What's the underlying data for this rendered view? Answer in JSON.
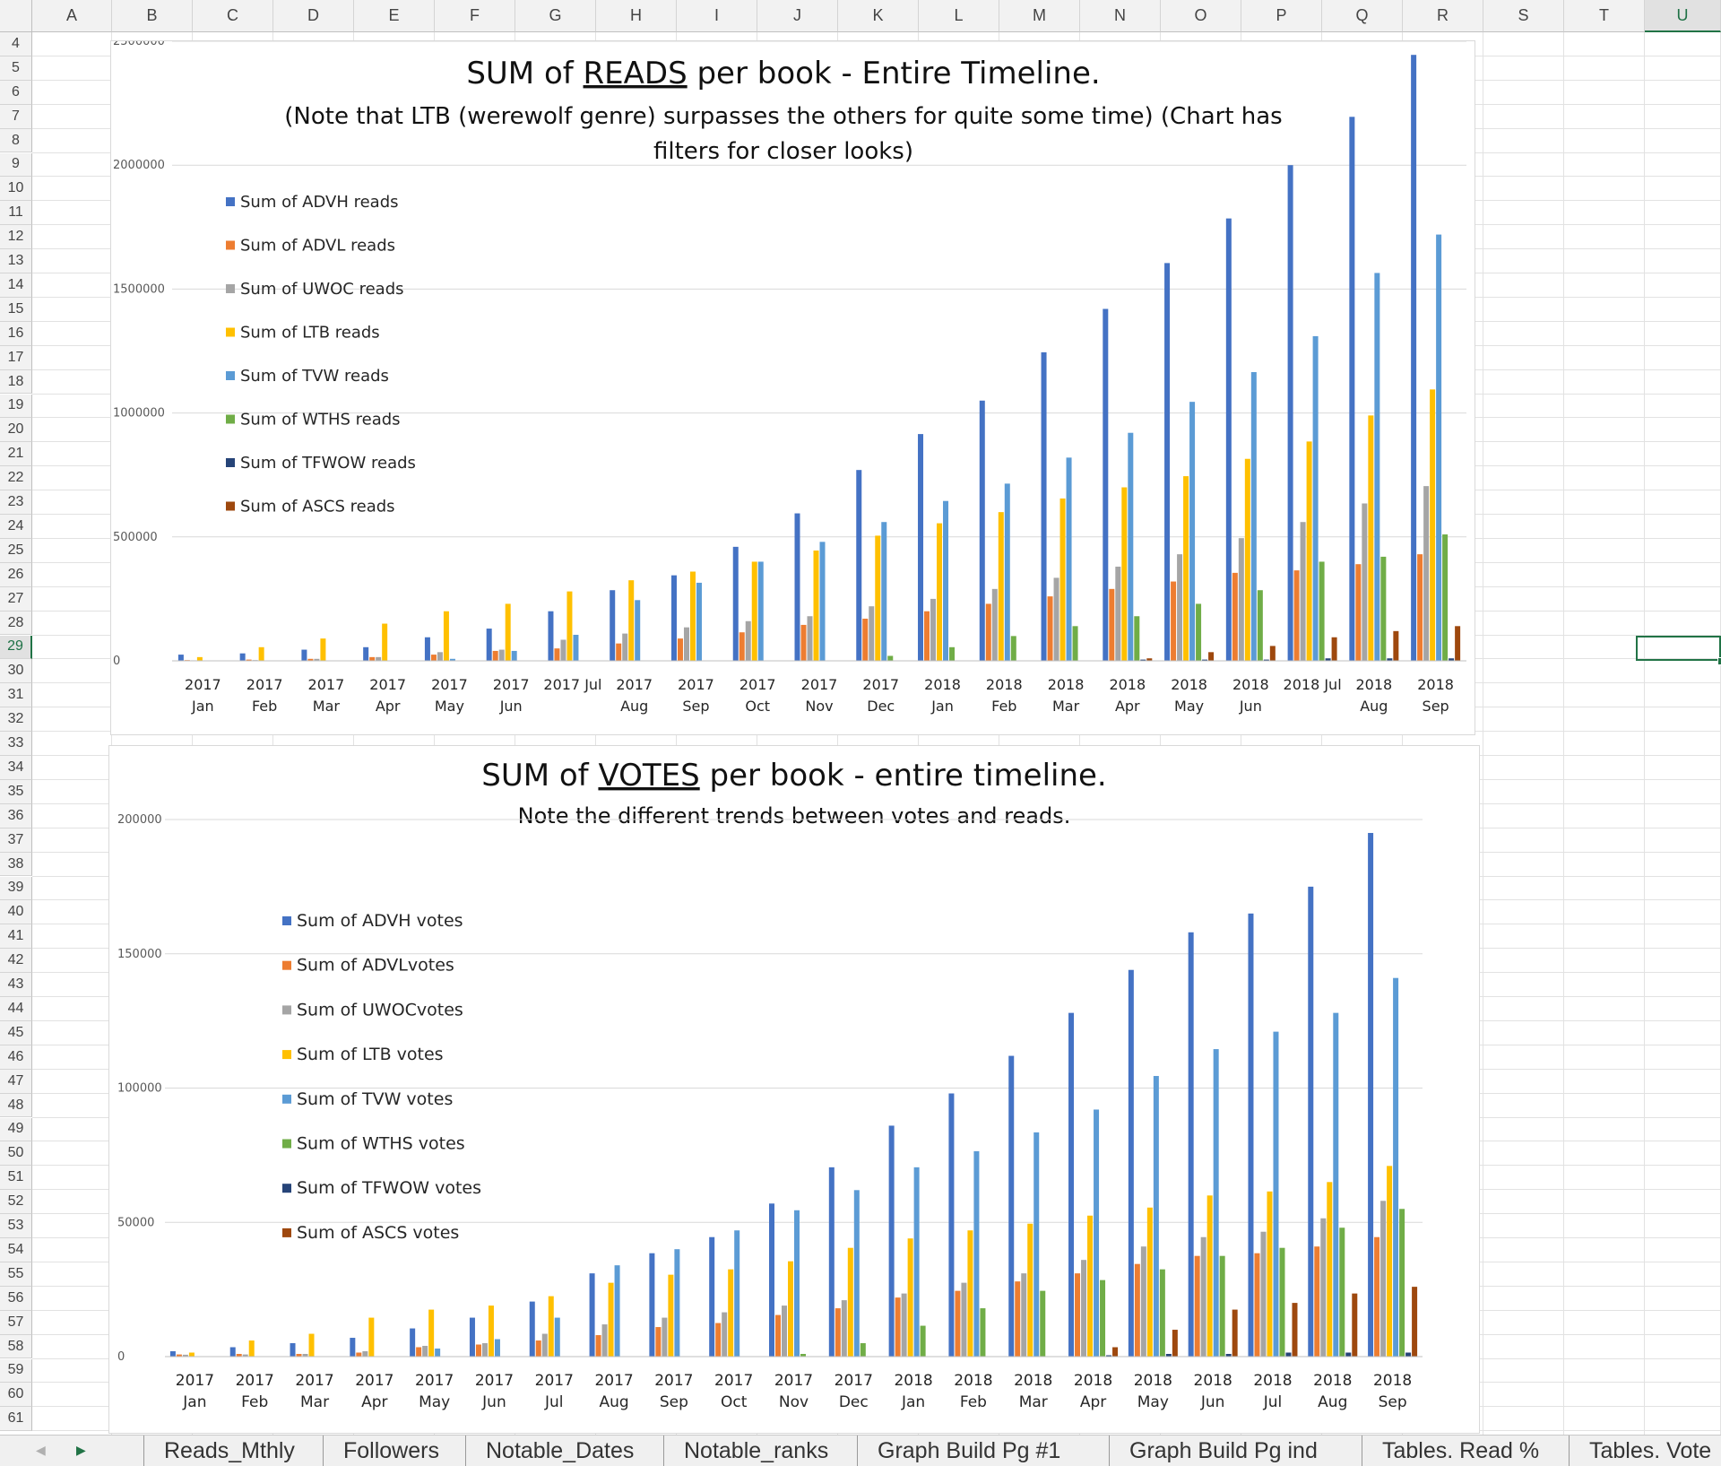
{
  "grid": {
    "columns": [
      "A",
      "B",
      "C",
      "D",
      "E",
      "F",
      "G",
      "H",
      "I",
      "J",
      "K",
      "L",
      "M",
      "N",
      "O",
      "P",
      "Q",
      "R",
      "S",
      "T",
      "U"
    ],
    "rows": [
      "4",
      "5",
      "6",
      "7",
      "8",
      "9",
      "10",
      "11",
      "12",
      "13",
      "14",
      "15",
      "16",
      "17",
      "18",
      "19",
      "20",
      "21",
      "22",
      "23",
      "24",
      "25",
      "26",
      "27",
      "28",
      "29",
      "30",
      "31",
      "32",
      "33",
      "34",
      "35",
      "36",
      "37",
      "38",
      "39",
      "40",
      "41",
      "42",
      "43",
      "44",
      "45",
      "46",
      "47",
      "48",
      "49",
      "50",
      "51",
      "52",
      "53",
      "54",
      "55",
      "56",
      "57",
      "58",
      "59",
      "60",
      "61"
    ],
    "selected_column": "U",
    "selected_row": "29"
  },
  "colors": {
    "series": [
      "#4472c4",
      "#ed7d31",
      "#a5a5a5",
      "#ffc000",
      "#5b9bd5",
      "#70ad47",
      "#264478",
      "#9e480e"
    ],
    "selection": "#217346"
  },
  "sheet_tabs": [
    "Reads_Mthly",
    "Followers",
    "Notable_Dates",
    "Notable_ranks",
    "Graph Build Pg #1",
    "Graph Build Pg ind",
    "Tables. Read %",
    "Tables. Vote"
  ],
  "chart_data": [
    {
      "type": "bar",
      "title_prefix": "SUM of ",
      "title_emph": "READS",
      "title_suffix": " per book - Entire Timeline.",
      "subtitle_lines": [
        "(Note that LTB (werewolf genre) surpasses the others for quite some time) (Chart has",
        "filters for closer looks)"
      ],
      "categories": [
        [
          "2017",
          "Jan"
        ],
        [
          "2017",
          "Feb"
        ],
        [
          "2017",
          "Mar"
        ],
        [
          "2017",
          "Apr"
        ],
        [
          "2017",
          "May"
        ],
        [
          "2017",
          "Jun"
        ],
        [
          "2017 Jul",
          ""
        ],
        [
          "2017",
          "Aug"
        ],
        [
          "2017",
          "Sep"
        ],
        [
          "2017",
          "Oct"
        ],
        [
          "2017",
          "Nov"
        ],
        [
          "2017",
          "Dec"
        ],
        [
          "2018",
          "Jan"
        ],
        [
          "2018",
          "Feb"
        ],
        [
          "2018",
          "Mar"
        ],
        [
          "2018",
          "Apr"
        ],
        [
          "2018",
          "May"
        ],
        [
          "2018",
          "Jun"
        ],
        [
          "2018 Jul",
          ""
        ],
        [
          "2018",
          "Aug"
        ],
        [
          "2018",
          "Sep"
        ]
      ],
      "ylim": [
        0,
        2500000
      ],
      "yticks": [
        "0",
        "500000",
        "1000000",
        "1500000",
        "2000000",
        "2500000"
      ],
      "grid": true,
      "legend_position": "left",
      "series": [
        {
          "name": "Sum of ADVH reads",
          "values": [
            25000,
            30000,
            45000,
            55000,
            95000,
            130000,
            200000,
            285000,
            345000,
            460000,
            595000,
            770000,
            915000,
            1050000,
            1245000,
            1420000,
            1605000,
            1785000,
            2000000,
            2195000,
            2445000
          ]
        },
        {
          "name": "Sum of ADVL reads",
          "values": [
            3000,
            5000,
            8000,
            15000,
            25000,
            40000,
            50000,
            70000,
            90000,
            115000,
            145000,
            170000,
            200000,
            230000,
            260000,
            290000,
            320000,
            355000,
            365000,
            390000,
            430000
          ]
        },
        {
          "name": "Sum of UWOC reads",
          "values": [
            2000,
            3000,
            8000,
            15000,
            35000,
            45000,
            85000,
            110000,
            135000,
            160000,
            180000,
            220000,
            250000,
            290000,
            335000,
            380000,
            430000,
            495000,
            560000,
            635000,
            705000
          ]
        },
        {
          "name": "Sum of LTB reads",
          "values": [
            15000,
            55000,
            90000,
            150000,
            200000,
            230000,
            280000,
            325000,
            360000,
            400000,
            445000,
            505000,
            555000,
            600000,
            655000,
            700000,
            745000,
            815000,
            885000,
            990000,
            1095000
          ]
        },
        {
          "name": "Sum of TVW reads",
          "values": [
            0,
            0,
            0,
            0,
            8000,
            40000,
            105000,
            245000,
            315000,
            400000,
            480000,
            560000,
            645000,
            715000,
            820000,
            920000,
            1045000,
            1165000,
            1310000,
            1565000,
            1720000
          ]
        },
        {
          "name": "Sum of WTHS reads",
          "values": [
            0,
            0,
            0,
            0,
            0,
            0,
            0,
            0,
            0,
            0,
            0,
            20000,
            55000,
            100000,
            140000,
            180000,
            230000,
            285000,
            400000,
            420000,
            510000
          ]
        },
        {
          "name": "Sum of TFWOW reads",
          "values": [
            0,
            0,
            0,
            0,
            0,
            0,
            0,
            0,
            0,
            0,
            0,
            0,
            0,
            0,
            0,
            5000,
            5000,
            5000,
            10000,
            10000,
            10000
          ]
        },
        {
          "name": "Sum of ASCS reads",
          "values": [
            0,
            0,
            0,
            0,
            0,
            0,
            0,
            0,
            0,
            0,
            0,
            0,
            0,
            0,
            0,
            10000,
            35000,
            60000,
            95000,
            120000,
            140000
          ]
        }
      ]
    },
    {
      "type": "bar",
      "title_prefix": "SUM of ",
      "title_emph": "VOTES",
      "title_suffix": " per book - entire timeline.",
      "subtitle_lines": [
        "Note the different trends between votes and reads."
      ],
      "categories": [
        [
          "2017",
          "Jan"
        ],
        [
          "2017",
          "Feb"
        ],
        [
          "2017",
          "Mar"
        ],
        [
          "2017",
          "Apr"
        ],
        [
          "2017",
          "May"
        ],
        [
          "2017",
          "Jun"
        ],
        [
          "2017",
          "Jul"
        ],
        [
          "2017",
          "Aug"
        ],
        [
          "2017",
          "Sep"
        ],
        [
          "2017",
          "Oct"
        ],
        [
          "2017",
          "Nov"
        ],
        [
          "2017",
          "Dec"
        ],
        [
          "2018",
          "Jan"
        ],
        [
          "2018",
          "Feb"
        ],
        [
          "2018",
          "Mar"
        ],
        [
          "2018",
          "Apr"
        ],
        [
          "2018",
          "May"
        ],
        [
          "2018",
          "Jun"
        ],
        [
          "2018",
          "Jul"
        ],
        [
          "2018",
          "Aug"
        ],
        [
          "2018",
          "Sep"
        ]
      ],
      "ylim": [
        0,
        200000
      ],
      "yticks": [
        "0",
        "50000",
        "100000",
        "150000",
        "200000"
      ],
      "grid": true,
      "legend_position": "left",
      "series": [
        {
          "name": "Sum of ADVH votes",
          "values": [
            2000,
            3500,
            5000,
            7000,
            10500,
            14500,
            20500,
            31000,
            38500,
            44500,
            57000,
            70500,
            86000,
            98000,
            112000,
            128000,
            144000,
            158000,
            165000,
            175000,
            195000
          ]
        },
        {
          "name": "Sum of ADVLvotes",
          "values": [
            800,
            1000,
            1000,
            1500,
            3500,
            4500,
            6000,
            8000,
            11000,
            12500,
            15500,
            18000,
            22000,
            24500,
            28000,
            31000,
            34500,
            37500,
            38500,
            41000,
            44500
          ]
        },
        {
          "name": "Sum of UWOCvotes",
          "values": [
            700,
            800,
            1000,
            2000,
            4000,
            5000,
            8500,
            12000,
            14500,
            16500,
            19000,
            21000,
            23500,
            27500,
            31000,
            36000,
            41000,
            44500,
            46500,
            51500,
            58000
          ]
        },
        {
          "name": "Sum of LTB votes",
          "values": [
            1500,
            6000,
            8500,
            14500,
            17500,
            19000,
            22500,
            27500,
            30500,
            32500,
            35500,
            40500,
            44000,
            47000,
            49500,
            52500,
            55500,
            60000,
            61500,
            65000,
            71000
          ]
        },
        {
          "name": "Sum of TVW votes",
          "values": [
            0,
            0,
            0,
            0,
            3000,
            6500,
            14500,
            34000,
            40000,
            47000,
            54500,
            62000,
            70500,
            76500,
            83500,
            92000,
            104500,
            114500,
            121000,
            128000,
            141000
          ]
        },
        {
          "name": "Sum of WTHS votes",
          "values": [
            0,
            0,
            0,
            0,
            0,
            0,
            0,
            0,
            0,
            0,
            1000,
            5000,
            11500,
            18000,
            24500,
            28500,
            32500,
            37500,
            40500,
            48000,
            55000
          ]
        },
        {
          "name": "Sum of TFWOW votes",
          "values": [
            0,
            0,
            0,
            0,
            0,
            0,
            0,
            0,
            0,
            0,
            0,
            0,
            0,
            0,
            0,
            500,
            1000,
            1000,
            1500,
            1500,
            1500
          ]
        },
        {
          "name": "Sum of ASCS votes",
          "values": [
            0,
            0,
            0,
            0,
            0,
            0,
            0,
            0,
            0,
            0,
            0,
            0,
            0,
            0,
            0,
            3500,
            10000,
            17500,
            20000,
            23500,
            26000
          ]
        }
      ]
    }
  ]
}
